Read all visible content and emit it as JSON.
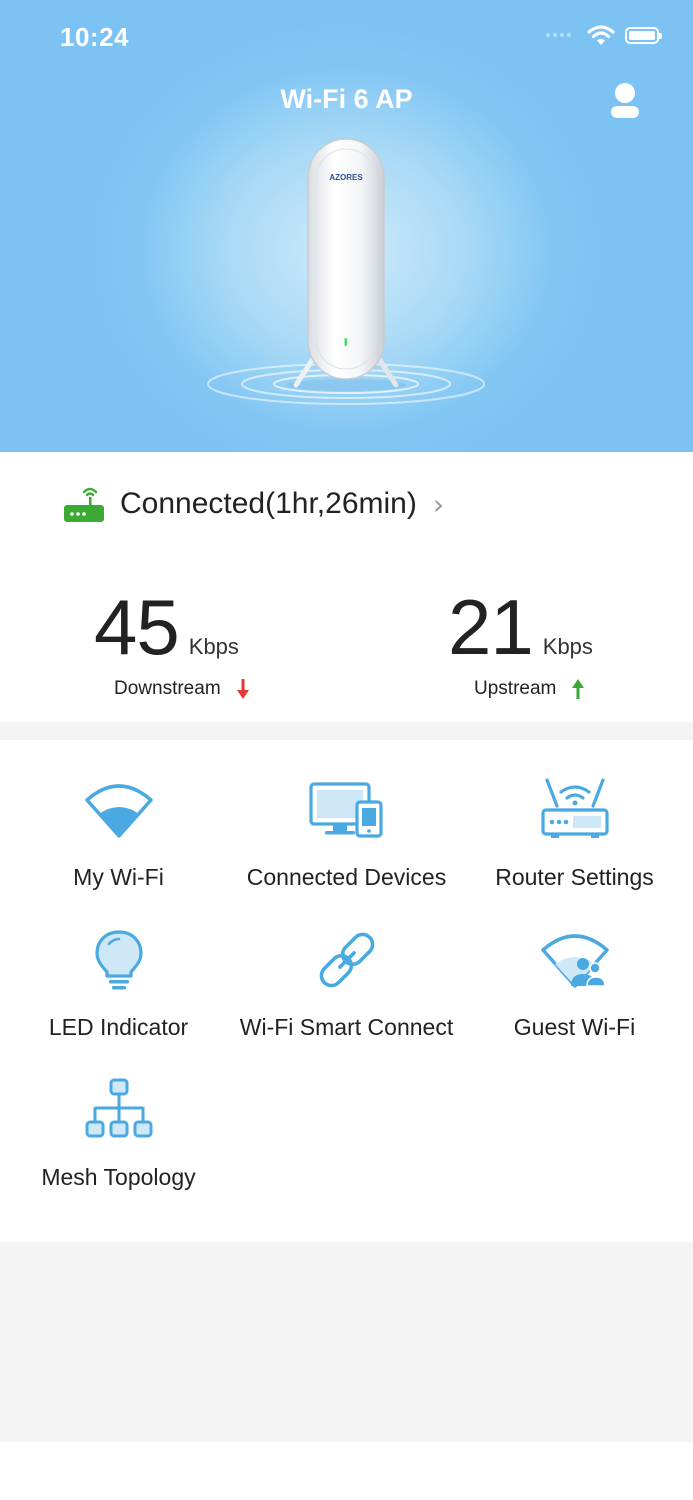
{
  "status_bar": {
    "time": "10:24"
  },
  "header": {
    "title": "Wi-Fi 6 AP",
    "device_brand": "AZORES"
  },
  "connection": {
    "status": "Connected(1hr,26min)"
  },
  "speeds": {
    "downstream": {
      "value": "45",
      "unit": "Kbps",
      "label": "Downstream"
    },
    "upstream": {
      "value": "21",
      "unit": "Kbps",
      "label": "Upstream"
    }
  },
  "colors": {
    "accent": "#4aa9e0",
    "hero": "#7cc3f4",
    "connected": "#3aaa35",
    "down_arrow": "#e53935",
    "up_arrow": "#3aaa35"
  },
  "menu": {
    "items": [
      {
        "label": "My Wi-Fi",
        "icon": "wifi-icon"
      },
      {
        "label": "Connected Devices",
        "icon": "devices-icon"
      },
      {
        "label": "Router Settings",
        "icon": "router-icon"
      },
      {
        "label": "LED Indicator",
        "icon": "bulb-icon"
      },
      {
        "label": "Wi-Fi Smart Connect",
        "icon": "link-icon"
      },
      {
        "label": "Guest Wi-Fi",
        "icon": "guest-wifi-icon"
      },
      {
        "label": "Mesh Topology",
        "icon": "mesh-topology-icon"
      }
    ]
  }
}
